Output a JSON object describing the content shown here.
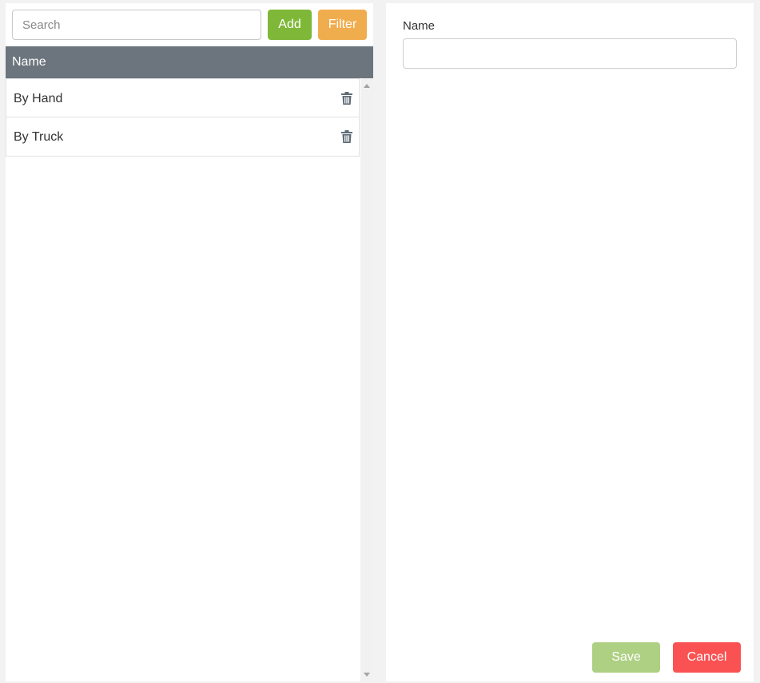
{
  "search": {
    "placeholder": "Search",
    "value": ""
  },
  "toolbar": {
    "add_label": "Add",
    "filter_label": "Filter"
  },
  "list": {
    "header": "Name",
    "items": [
      {
        "label": "By Hand"
      },
      {
        "label": "By Truck"
      }
    ]
  },
  "form": {
    "name_label": "Name",
    "name_value": "",
    "save_label": "Save",
    "cancel_label": "Cancel"
  },
  "colors": {
    "add": "#7fb838",
    "filter": "#f0ad4e",
    "header": "#6c757d",
    "save": "#aed083",
    "cancel": "#fa5253"
  },
  "icons": {
    "row_action": "trash-icon"
  }
}
